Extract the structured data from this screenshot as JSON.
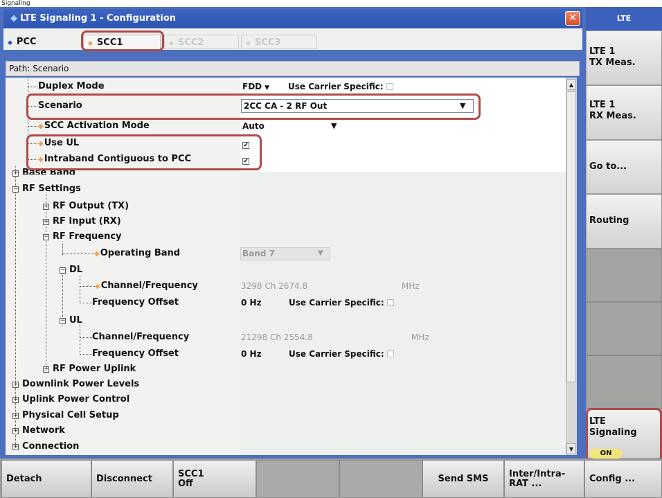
{
  "top_text": "Signaling",
  "window": {
    "title": "LTE Signaling 1 - Configuration",
    "close": "✕",
    "tabs": [
      "PCC",
      "SCC1",
      "SCC2",
      "SCC3"
    ],
    "path_label": "Path:",
    "path_value": "Scenario"
  },
  "tree": {
    "duplex_mode": "Duplex Mode",
    "scenario": "Scenario",
    "scc_activation_mode": "SCC Activation Mode",
    "use_ul": "Use UL",
    "intraband": "Intraband Contiguous to PCC",
    "base_band": "Base Band",
    "rf_settings": "RF Settings",
    "rf_output": "RF Output (TX)",
    "rf_input": "RF Input (RX)",
    "rf_frequency": "RF Frequency",
    "operating_band": "Operating Band",
    "dl": "DL",
    "dl_channel_frequency": "Channel/Frequency",
    "dl_frequency_offset": "Frequency Offset",
    "ul": "UL",
    "ul_channel_frequency": "Channel/Frequency",
    "ul_frequency_offset": "Frequency Offset",
    "rf_power_uplink": "RF Power Uplink",
    "downlink_power_levels": "Downlink Power Levels",
    "uplink_power_control": "Uplink Power Control",
    "physical_cell_setup": "Physical Cell Setup",
    "network": "Network",
    "connection": "Connection"
  },
  "values": {
    "duplex_mode": "FDD",
    "use_carrier_specific": "Use Carrier Specific:",
    "scenario": "2CC CA - 2 RF Out",
    "scc_activation_mode": "Auto",
    "use_ul_checked": "✔",
    "intraband_checked": "✔",
    "operating_band": "Band 7",
    "dl_channel": "3298 Ch 2674.8",
    "dl_unit": "MHz",
    "dl_offset": "0 Hz",
    "ul_channel": "21298 Ch 2554.8",
    "ul_unit": "MHz",
    "ul_offset": "0 Hz"
  },
  "right_softkeys": {
    "header": "LTE",
    "lte_tx": "LTE 1\nTX Meas.",
    "lte_rx": "LTE 1\nRX Meas.",
    "goto": "Go to...",
    "routing": "Routing",
    "lte_signaling": "LTE\nSignaling",
    "on_badge": "ON"
  },
  "bottom_softkeys": {
    "detach": "Detach",
    "disconnect": "Disconnect",
    "scc1_off": "SCC1\nOff",
    "send_sms": "Send SMS",
    "inter_intra_rat": "Inter/Intra-\nRAT ...",
    "config": "Config ..."
  },
  "colors": {
    "title_blue": "#3e64bf",
    "highlight_red": "#b04a4a",
    "on_yellow": "#f4e57a",
    "bullet_orange": "#f0a05a"
  }
}
